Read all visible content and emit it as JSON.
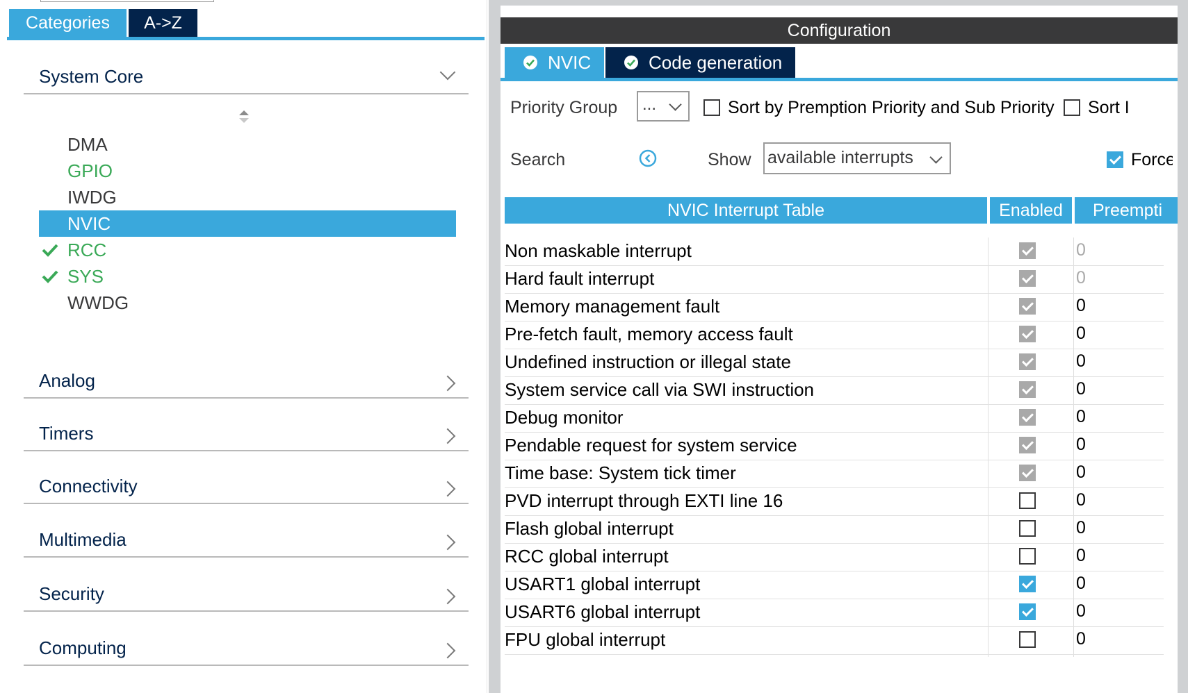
{
  "left": {
    "tabs": [
      {
        "label": "Categories",
        "active": true
      },
      {
        "label": "A->Z",
        "active": false
      }
    ],
    "system_core": {
      "label": "System Core",
      "expanded": true,
      "items": [
        {
          "label": "DMA",
          "status": "none",
          "color": "#39393a"
        },
        {
          "label": "GPIO",
          "status": "none",
          "color": "#3aa957"
        },
        {
          "label": "IWDG",
          "status": "none",
          "color": "#39393a"
        },
        {
          "label": "NVIC",
          "status": "selected",
          "color": "#ffffff"
        },
        {
          "label": "RCC",
          "status": "ok",
          "color": "#3aa957"
        },
        {
          "label": "SYS",
          "status": "ok",
          "color": "#3aa957"
        },
        {
          "label": "WWDG",
          "status": "none",
          "color": "#39393a"
        }
      ]
    },
    "categories": [
      "Analog",
      "Timers",
      "Connectivity",
      "Multimedia",
      "Security",
      "Computing"
    ]
  },
  "right": {
    "title": "Configuration",
    "tabs": [
      {
        "label": "NVIC",
        "active": true
      },
      {
        "label": "Code generation",
        "active": false
      }
    ],
    "options": {
      "priority_group_label": "Priority Group",
      "priority_group_value": "...",
      "sort_label": "Sort by Premption Priority and Sub Priority",
      "sort2_label": "Sort I",
      "search_label": "Search",
      "show_label": "Show",
      "show_value": "available interrupts",
      "force_label": "Force"
    },
    "table": {
      "headers": [
        "NVIC Interrupt Table",
        "Enabled",
        "Preempti"
      ],
      "rows": [
        {
          "name": "Non maskable interrupt",
          "enabled": "forced",
          "preemption": "0",
          "editable": false
        },
        {
          "name": "Hard fault interrupt",
          "enabled": "forced",
          "preemption": "0",
          "editable": false
        },
        {
          "name": "Memory management fault",
          "enabled": "forced",
          "preemption": "0",
          "editable": true
        },
        {
          "name": "Pre-fetch fault, memory access fault",
          "enabled": "forced",
          "preemption": "0",
          "editable": true
        },
        {
          "name": "Undefined instruction or illegal state",
          "enabled": "forced",
          "preemption": "0",
          "editable": true
        },
        {
          "name": "System service call via SWI instruction",
          "enabled": "forced",
          "preemption": "0",
          "editable": true
        },
        {
          "name": "Debug monitor",
          "enabled": "forced",
          "preemption": "0",
          "editable": true
        },
        {
          "name": "Pendable request for system service",
          "enabled": "forced",
          "preemption": "0",
          "editable": true
        },
        {
          "name": "Time base: System tick timer",
          "enabled": "forced",
          "preemption": "0",
          "editable": true
        },
        {
          "name": "PVD interrupt through EXTI line 16",
          "enabled": "off",
          "preemption": "0",
          "editable": true
        },
        {
          "name": "Flash global interrupt",
          "enabled": "off",
          "preemption": "0",
          "editable": true
        },
        {
          "name": "RCC global interrupt",
          "enabled": "off",
          "preemption": "0",
          "editable": true
        },
        {
          "name": "USART1 global interrupt",
          "enabled": "on",
          "preemption": "0",
          "editable": true
        },
        {
          "name": "USART6 global interrupt",
          "enabled": "on",
          "preemption": "0",
          "editable": true
        },
        {
          "name": "FPU global interrupt",
          "enabled": "off",
          "preemption": "0",
          "editable": true
        }
      ]
    }
  },
  "colors": {
    "accent": "#3aa8dc",
    "navy": "#03234b",
    "ok_green": "#3aa957",
    "title_bar": "#39393a"
  }
}
